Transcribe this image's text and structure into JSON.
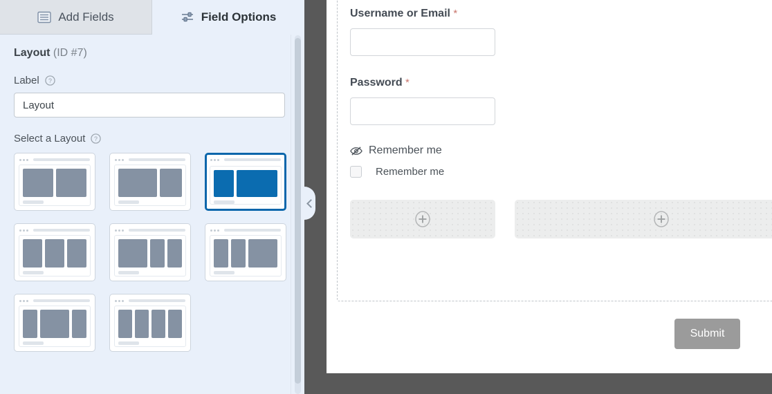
{
  "tabs": [
    {
      "label": "Add Fields",
      "icon": "list-icon",
      "active": false
    },
    {
      "label": "Field Options",
      "icon": "sliders-icon",
      "active": true
    }
  ],
  "field_options": {
    "title": "Layout",
    "id_text": "(ID #7)",
    "label_heading": "Label",
    "label_value": "Layout",
    "select_layout_heading": "Select a Layout",
    "help_icon": "question-circle-icon",
    "layouts": [
      {
        "name": "two-equal-columns",
        "columns": [
          50,
          50
        ],
        "selected": false
      },
      {
        "name": "two-thirds-one-third",
        "columns": [
          64,
          36
        ],
        "selected": false
      },
      {
        "name": "one-third-two-thirds",
        "columns": [
          33,
          67
        ],
        "selected": true
      },
      {
        "name": "three-equal-columns",
        "columns": [
          33,
          33,
          33
        ],
        "selected": false
      },
      {
        "name": "half-quarter-quarter",
        "columns": [
          50,
          25,
          25
        ],
        "selected": false
      },
      {
        "name": "quarter-quarter-half",
        "columns": [
          25,
          25,
          50
        ],
        "selected": false
      },
      {
        "name": "quarter-half-quarter",
        "columns": [
          25,
          50,
          25
        ],
        "selected": false
      },
      {
        "name": "four-equal-columns",
        "columns": [
          25,
          25,
          25,
          25
        ],
        "selected": false
      }
    ]
  },
  "collapse_handle": {
    "icon": "chevron-left-icon"
  },
  "preview": {
    "fields": [
      {
        "label": "Username or Email",
        "required_marker": "*"
      },
      {
        "label": "Password",
        "required_marker": "*"
      }
    ],
    "remember_me": {
      "hidden_label_icon": "eye-slash-icon",
      "heading": "Remember me",
      "checkbox_label": "Remember me",
      "checked": false
    },
    "dropzones": [
      {
        "name": "dropzone-left",
        "icon": "plus-circle-icon"
      },
      {
        "name": "dropzone-right",
        "icon": "plus-circle-icon"
      }
    ],
    "submit_label": "Submit"
  },
  "colors": {
    "accent_blue": "#0a66ab",
    "sidebar_bg": "#e9f0fa",
    "backdrop": "#595959",
    "required_red": "#c9766d",
    "submit_gray": "#9b9b9b"
  }
}
